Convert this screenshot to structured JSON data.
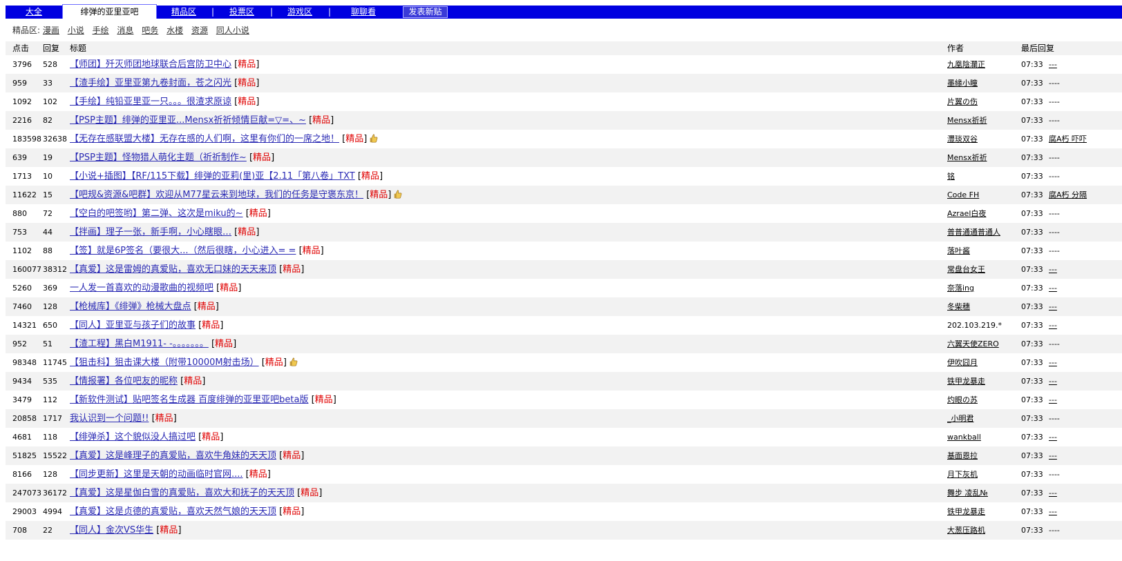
{
  "nav": {
    "tabs": [
      {
        "label": "大全"
      },
      {
        "label": "绯弹的亚里亚吧",
        "active": true
      },
      {
        "label": "精品区"
      },
      {
        "label": "投票区"
      },
      {
        "label": "游戏区"
      },
      {
        "label": "聊聊看"
      }
    ],
    "separator": "|",
    "post_button": "发表新贴"
  },
  "subnav": {
    "label": "精品区:",
    "items": [
      "漫画",
      "小说",
      "手绘",
      "消息",
      "吧务",
      "水楼",
      "资源",
      "同人小说"
    ]
  },
  "table": {
    "headers": {
      "clicks": "点击",
      "replies": "回复",
      "title": "标题",
      "author": "作者",
      "last_reply": "最后回复"
    },
    "tag_label": "精品",
    "rows": [
      {
        "clicks": "3796",
        "replies": "528",
        "title": "【师团】歼灭师团地球联合后宫防卫中心",
        "author": "九凰陰瀾正",
        "time": "07:33",
        "last": "---",
        "last_link": true
      },
      {
        "clicks": "959",
        "replies": "33",
        "title": "【渣手绘】亚里亚第九卷封面，苍之闪光",
        "author": "墨緣小瞳",
        "time": "07:33",
        "last": "----",
        "last_link": false
      },
      {
        "clicks": "1092",
        "replies": "102",
        "title": "【手绘】纯铅亚里亚一只。。。很渣求原谅",
        "author": "片翼の伤",
        "time": "07:33",
        "last": "----",
        "last_link": false
      },
      {
        "clicks": "2216",
        "replies": "82",
        "title": "【PSP主题】绯弹的亚里亚...Mensx祈祈倾情巨献=▽=、~",
        "author": "Mensx祈祈",
        "time": "07:33",
        "last": "----",
        "last_link": false
      },
      {
        "clicks": "183598",
        "replies": "32638",
        "title": "【无存在感联盟大楼】无存在感的人们啊，这里有你们的一席之地！",
        "author": "灃琰双谷",
        "time": "07:33",
        "last": "腐A朽 吓吓",
        "last_link": true,
        "thumb": true
      },
      {
        "clicks": "639",
        "replies": "19",
        "title": "【PSP主题】怪物猎人萌化主题（祈祈制作~",
        "author": "Mensx祈祈",
        "time": "07:33",
        "last": "----",
        "last_link": false
      },
      {
        "clicks": "1713",
        "replies": "10",
        "title": "【小说+插图】【RF/115下载】绯弹的亚莉(里)亚【2.11「第八卷」TXT",
        "author": "铭",
        "time": "07:33",
        "last": "----",
        "last_link": false
      },
      {
        "clicks": "11622",
        "replies": "15",
        "title": "【吧规&资源&吧群】欢迎从M77星云来到地球，我们的任务是守褒东京！",
        "author": "Code FH",
        "time": "07:33",
        "last": "腐A朽 分隔",
        "last_link": true,
        "thumb": true
      },
      {
        "clicks": "880",
        "replies": "72",
        "title": "【空白的吧签哟】第二弹、这次是miku的~",
        "author": "Azrael白夜",
        "time": "07:33",
        "last": "----",
        "last_link": false
      },
      {
        "clicks": "753",
        "replies": "44",
        "title": "【拌画】理子一张，新手啊，小心瞎眼…",
        "author": "普普通通普通人",
        "time": "07:33",
        "last": "----",
        "last_link": false
      },
      {
        "clicks": "1102",
        "replies": "88",
        "title": "【签】就是6P签名（要很大...（然后很瞎，小心进入= =",
        "author": "落叶酱",
        "time": "07:33",
        "last": "----",
        "last_link": false
      },
      {
        "clicks": "160077",
        "replies": "38312",
        "title": "【真爱】这是雷姆的真爱贴，喜欢无口妹的天天来顶",
        "author": "常盘台女王",
        "time": "07:33",
        "last": "---",
        "last_link": true
      },
      {
        "clicks": "5260",
        "replies": "369",
        "title": "一人发一首喜欢的动漫歌曲的视频吧",
        "author": "奈落ing",
        "time": "07:33",
        "last": "---",
        "last_link": true
      },
      {
        "clicks": "7460",
        "replies": "128",
        "title": "【枪械库】《绯弹》枪械大盘点",
        "author": "冬柴穗",
        "time": "07:33",
        "last": "---",
        "last_link": true
      },
      {
        "clicks": "14321",
        "replies": "650",
        "title": "【同人】亚里亚与孩子们的故事",
        "author": "202.103.219.*",
        "time": "07:33",
        "last": "---",
        "last_link": true,
        "author_plain": true
      },
      {
        "clicks": "952",
        "replies": "51",
        "title": "【渣工程】黑白M1911- -。。。。。。。",
        "author": "六翼天使ZERO",
        "time": "07:33",
        "last": "----",
        "last_link": false
      },
      {
        "clicks": "98348",
        "replies": "11745",
        "title": "【狙击科】狙击课大楼（附带10000M射击场）",
        "author": "伊吹囧月",
        "time": "07:33",
        "last": "---",
        "last_link": true,
        "thumb": true
      },
      {
        "clicks": "9434",
        "replies": "535",
        "title": "【情报署】各位吧友的昵称",
        "author": "铁甲龙暴走",
        "time": "07:33",
        "last": "---",
        "last_link": true
      },
      {
        "clicks": "3479",
        "replies": "112",
        "title": "【新软件测试】贴吧签名生成器 百度绯弹的亚里亚吧beta版",
        "author": "灼眼の苏",
        "time": "07:33",
        "last": "---",
        "last_link": true
      },
      {
        "clicks": "20858",
        "replies": "1717",
        "title": "我认识到一个问题!!",
        "author": "_小明君",
        "time": "07:33",
        "last": "----",
        "last_link": false
      },
      {
        "clicks": "4681",
        "replies": "118",
        "title": "【绯弹杀】这个貌似没人搞过吧",
        "author": "wankball",
        "time": "07:33",
        "last": "---",
        "last_link": true
      },
      {
        "clicks": "51825",
        "replies": "15522",
        "title": "【真爱】这是峰理子的真爱贴，喜欢牛角妹的天天顶",
        "author": "基面恩拉",
        "time": "07:33",
        "last": "---",
        "last_link": true
      },
      {
        "clicks": "8166",
        "replies": "128",
        "title": "【同步更新】这里是天朝的动画临时官网....",
        "author": "月下灰机",
        "time": "07:33",
        "last": "----",
        "last_link": false
      },
      {
        "clicks": "247073",
        "replies": "36172",
        "title": "【真爱】这是星伽白雪的真爱贴，喜欢大和抚子的天天顶",
        "author": "舞步 凌乱№",
        "time": "07:33",
        "last": "---",
        "last_link": true
      },
      {
        "clicks": "29003",
        "replies": "4994",
        "title": "【真爱】这是贞德的真爱贴，喜欢天然气娘的天天顶",
        "author": "铁甲龙暴走",
        "time": "07:33",
        "last": "---",
        "last_link": true
      },
      {
        "clicks": "708",
        "replies": "22",
        "title": "【同人】金次VS华生",
        "author": "大葱压路机",
        "time": "07:33",
        "last": "----",
        "last_link": false
      }
    ]
  },
  "colors": {
    "nav_bg": "#0000e0",
    "link": "#2a2ab4",
    "tag": "#e00000",
    "row_alt": "#f2f2f2"
  },
  "icons": {
    "thumb": "thumbs-up-icon"
  }
}
